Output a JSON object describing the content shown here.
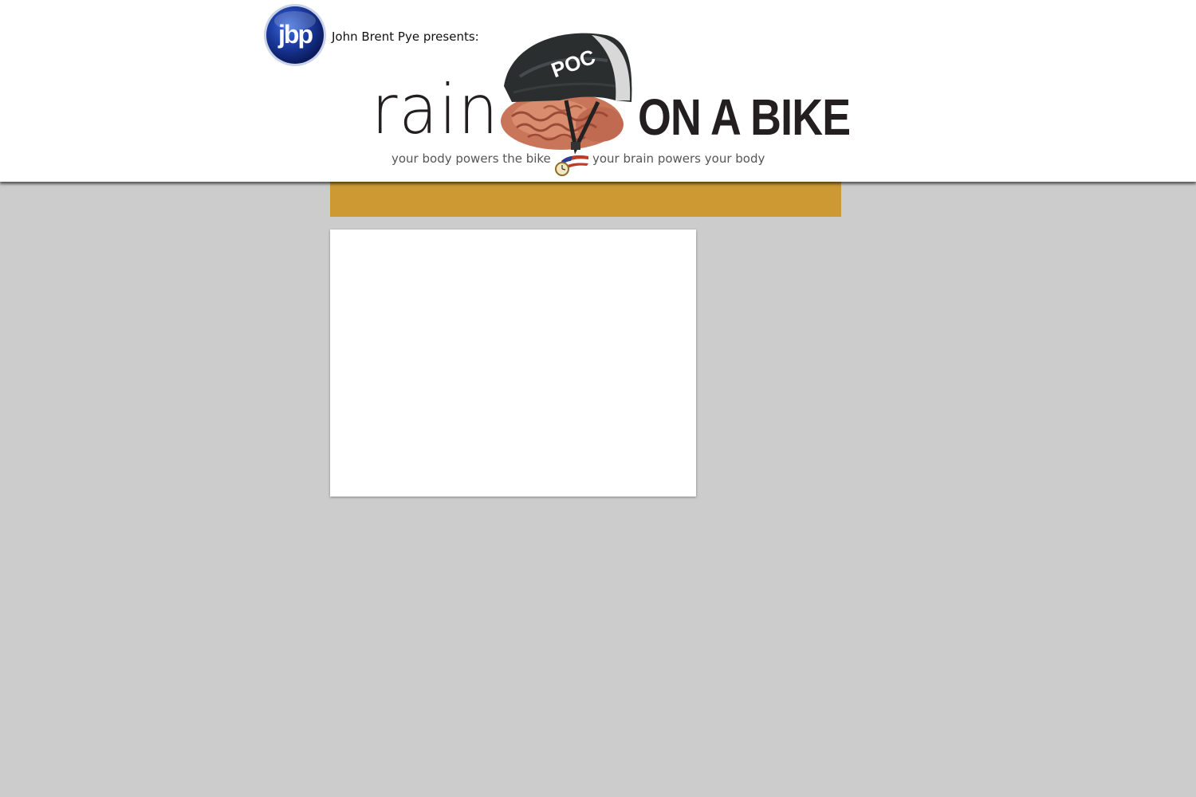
{
  "header": {
    "logo_text": "jbp",
    "presents": "John Brent Pye presents:",
    "title_part1": "rain",
    "title_part2": "ON A BIKE",
    "helmet_text": "POC",
    "tagline_left": "your body powers the bike",
    "tagline_right": "your brain powers your body"
  },
  "colors": {
    "background": "#cccccc",
    "header_bg": "#ffffff",
    "nav_bar": "#cc9933",
    "logo_blue": "#1a3a9e",
    "title_text": "#231f20"
  },
  "icons": {
    "logo": "jbp-circle-logo",
    "hero": "helmet-brain-image",
    "emblem": "flag-clock-emblem"
  },
  "nav": {
    "items": []
  },
  "content": {}
}
